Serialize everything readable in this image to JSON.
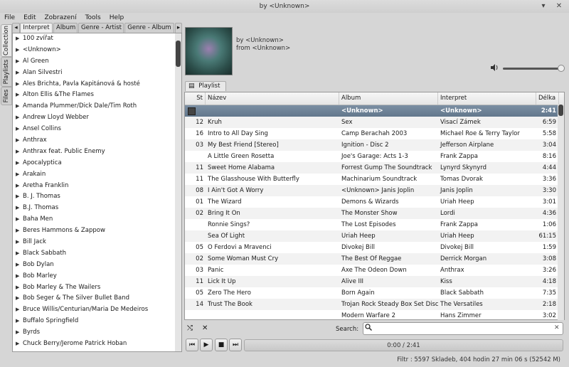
{
  "window": {
    "title": "by <Unknown>"
  },
  "menu": [
    "File",
    "Edit",
    "Zobrazení",
    "Tools",
    "Help"
  ],
  "side_tabs": [
    "Collection",
    "Playlists",
    "Files"
  ],
  "collection_tabs": [
    "Interpret",
    "Album",
    "Genre - Artist",
    "Genre - Album"
  ],
  "artists": [
    "100 zvířat",
    "<Unknown>",
    "Al Green",
    "Alan Silvestri",
    "Ales Brichta, Pavla Kapitánová & hosté",
    "Alton Ellis &The Flames",
    "Amanda Plummer/Dick Dale/Tim Roth",
    "Andrew Lloyd Webber",
    "Ansel Collins",
    "Anthrax",
    "Anthrax feat. Public Enemy",
    "Apocalyptica",
    "Arakain",
    "Aretha Franklin",
    "B. J. Thomas",
    "B.J. Thomas",
    "Baha Men",
    "Beres Hammons & Zappow",
    "Bill Jack",
    "Black Sabbath",
    "Bob Dylan",
    "Bob Marley",
    "Bob Marley & The Wailers",
    "Bob Seger & The Silver Bullet Band",
    "Bruce Willis/Centurian/Maria De Medeiros",
    "Buffalo Springfield",
    "Byrds",
    "Chuck Berry/Jerome Patrick Hoban"
  ],
  "now_playing": {
    "by": "by <Unknown>",
    "from": "from <Unknown>"
  },
  "playlist_tab": "Playlist 1",
  "columns": [
    "St",
    "Název",
    "Album",
    "Interpret",
    "Délka"
  ],
  "tracks": [
    {
      "st": "",
      "title": "",
      "album": "<Unknown>",
      "artist": "<Unknown>",
      "length": "2:41",
      "selected": true
    },
    {
      "st": "12",
      "title": "Kruh",
      "album": "Sex",
      "artist": "Visací Zámek",
      "length": "6:59"
    },
    {
      "st": "16",
      "title": "Intro to All Day Sing",
      "album": "Camp Berachah 2003",
      "artist": "Michael Roe & Terry Taylor",
      "length": "5:58"
    },
    {
      "st": "03",
      "title": "My Best Friend [Stereo]",
      "album": "Ignition - Disc 2",
      "artist": "Jefferson Airplane",
      "length": "3:04"
    },
    {
      "st": "",
      "title": "A Little Green Rosetta",
      "album": "Joe's Garage: Acts 1-3",
      "artist": "Frank Zappa",
      "length": "8:16"
    },
    {
      "st": "11",
      "title": "Sweet Home Alabama",
      "album": "Forrest Gump The Soundtrack",
      "artist": "Lynyrd Skynyrd",
      "length": "4:44"
    },
    {
      "st": "11",
      "title": "The Glasshouse With Butterfly",
      "album": "Machinarium Soundtrack",
      "artist": "Tomas Dvorak",
      "length": "3:36"
    },
    {
      "st": "08",
      "title": "I Ain't Got A Worry",
      "album": "<Unknown> Janis Joplin",
      "artist": "Janis Joplin",
      "length": "3:30"
    },
    {
      "st": "01",
      "title": "The Wizard",
      "album": "Demons & Wizards",
      "artist": "Uriah Heep",
      "length": "3:01"
    },
    {
      "st": "02",
      "title": "Bring It On",
      "album": "The Monster Show",
      "artist": "Lordi",
      "length": "4:36"
    },
    {
      "st": "",
      "title": "Ronnie Sings?",
      "album": "The Lost Episodes",
      "artist": "Frank Zappa",
      "length": "1:06"
    },
    {
      "st": "",
      "title": "Sea Of Light",
      "album": "Uriah Heep",
      "artist": "Uriah Heep",
      "length": "61:15"
    },
    {
      "st": "05",
      "title": "O Ferdovi a Mravenci",
      "album": "Divokej Bill",
      "artist": "Divokej Bill",
      "length": "1:59"
    },
    {
      "st": "02",
      "title": "Some Woman Must Cry",
      "album": "The Best Of Reggae",
      "artist": "Derrick Morgan",
      "length": "3:08"
    },
    {
      "st": "03",
      "title": "Panic",
      "album": "Axe The Odeon Down",
      "artist": "Anthrax",
      "length": "3:26"
    },
    {
      "st": "11",
      "title": "Lick It Up",
      "album": "Alive III",
      "artist": "Kiss",
      "length": "4:18"
    },
    {
      "st": "05",
      "title": "Zero The Hero",
      "album": "Born Again",
      "artist": "Black Sabbath",
      "length": "7:35"
    },
    {
      "st": "14",
      "title": "Trust The Book",
      "album": "Trojan Rock Steady Box Set  Disc",
      "artist": "The Versatiles",
      "length": "2:18"
    },
    {
      "st": "",
      "title": "",
      "album": "Modern Warfare 2",
      "artist": "Hans Zimmer",
      "length": "3:02"
    }
  ],
  "search": {
    "label": "Search:",
    "value": ""
  },
  "transport": {
    "time": "0:00 / 2:41"
  },
  "status": "Filtr : 5597 Skladeb, 404 hodin 27 min 06 s (52542 M)",
  "icons": {
    "minimize": "▾",
    "close": "✕",
    "prev": "⏮",
    "play": "▶",
    "stop": "■",
    "next": "⏭",
    "volume": "🔈",
    "search": "🔍",
    "shuffle": "⤭",
    "clear": "✕",
    "expand": "▶",
    "playlist": "▤"
  }
}
